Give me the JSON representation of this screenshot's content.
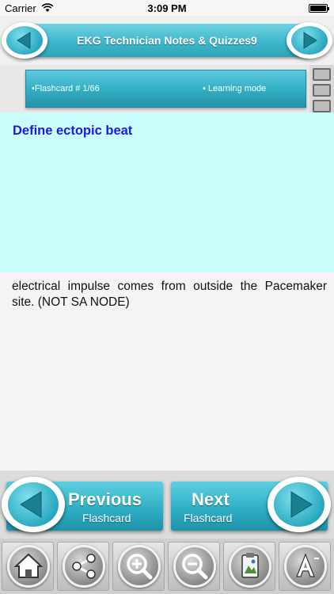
{
  "status_bar": {
    "carrier": "Carrier",
    "time": "3:09 PM",
    "battery_level": 1.0
  },
  "header": {
    "title": "EKG Technician Notes & Quizzes9",
    "back_icon": "left-arrow-icon",
    "forward_icon": "right-arrow-icon"
  },
  "info_strip": {
    "flashcard_label": "•Flashcard #  1/66",
    "mode_label": "• Learning mode",
    "film_icon": "film-strip-icon"
  },
  "card": {
    "question": "Define ectopic beat",
    "answer": "electrical impulse comes from outside the Pacemaker site. (NOT SA NODE)"
  },
  "navigation": {
    "previous": {
      "big": "Previous",
      "small": "Flashcard"
    },
    "next": {
      "big": "Next",
      "small": "Flashcard"
    }
  },
  "toolbar": {
    "items": [
      {
        "icon": "home-icon"
      },
      {
        "icon": "share-icon"
      },
      {
        "icon": "zoom-in-icon"
      },
      {
        "icon": "zoom-out-icon"
      },
      {
        "icon": "clipboard-icon"
      },
      {
        "icon": "font-size-icon"
      }
    ]
  },
  "colors": {
    "accent": "#34b0c6",
    "question_bg": "#ccfdfd",
    "question_text": "#1a1ae0"
  }
}
